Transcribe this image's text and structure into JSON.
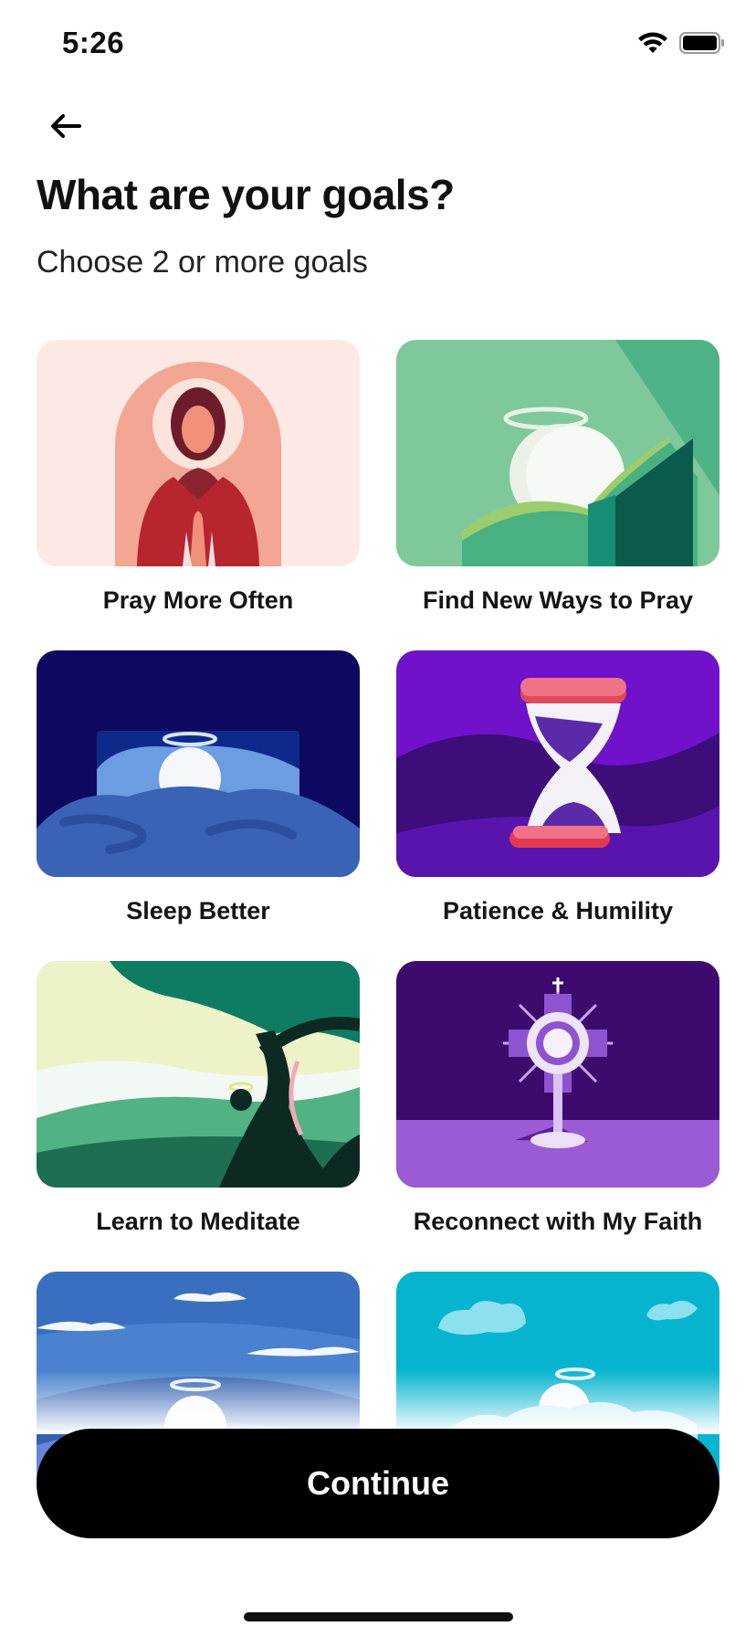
{
  "status_bar": {
    "time": "5:26",
    "icons": [
      "wifi-icon",
      "battery-icon"
    ]
  },
  "header": {
    "back_icon": "arrow-left-icon",
    "title": "What are your goals?",
    "subtitle": "Choose 2 or more goals"
  },
  "goals": [
    {
      "label": "Pray More Often",
      "illustration": "praying-figure",
      "bg": "#fde9e4"
    },
    {
      "label": "Find New Ways to Pray",
      "illustration": "halo-over-hills",
      "bg": "#7fc89c"
    },
    {
      "label": "Sleep Better",
      "illustration": "halo-in-bed",
      "bg": "#0e0960"
    },
    {
      "label": "Patience & Humility",
      "illustration": "hourglass",
      "bg": "#6f12c9"
    },
    {
      "label": "Learn to Meditate",
      "illustration": "tree-landscape",
      "bg": "#eef2c8"
    },
    {
      "label": "Reconnect with My Faith",
      "illustration": "monstrance",
      "bg": "#3d0a6e"
    },
    {
      "label": "",
      "illustration": "halo-over-sea",
      "bg": "#3a6fc0"
    },
    {
      "label": "",
      "illustration": "halo-in-clouds",
      "bg": "#06b4cf"
    }
  ],
  "actions": {
    "continue_label": "Continue"
  },
  "colors": {
    "primary_button": "#000000",
    "text": "#111111"
  }
}
